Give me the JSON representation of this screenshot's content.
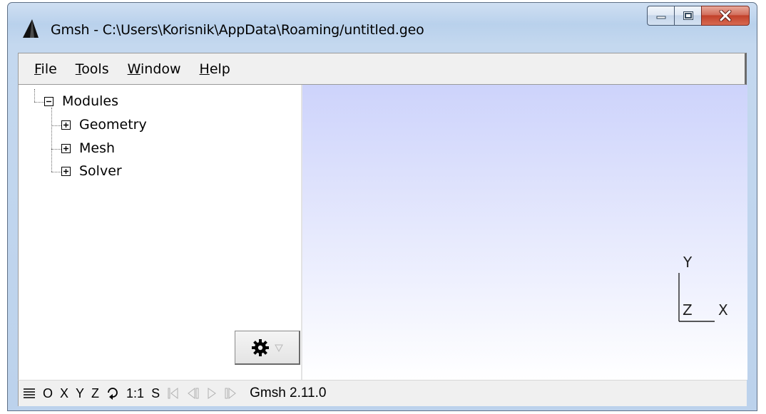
{
  "window": {
    "title": "Gmsh - C:\\Users\\Korisnik\\AppData\\Roaming/untitled.geo"
  },
  "menu": [
    {
      "label": "File",
      "mnemonic": "F",
      "rest": "ile"
    },
    {
      "label": "Tools",
      "mnemonic": "T",
      "rest": "ools"
    },
    {
      "label": "Window",
      "mnemonic": "W",
      "rest": "indow"
    },
    {
      "label": "Help",
      "mnemonic": "H",
      "rest": "elp"
    }
  ],
  "tree": {
    "root": {
      "label": "Modules",
      "expanded": true
    },
    "children": [
      {
        "label": "Geometry",
        "expanded": false
      },
      {
        "label": "Mesh",
        "expanded": false
      },
      {
        "label": "Solver",
        "expanded": false
      }
    ]
  },
  "axes": {
    "x": "X",
    "y": "Y",
    "z": "Z"
  },
  "statusbar": {
    "buttons": [
      "O",
      "X",
      "Y",
      "Z",
      "1:1",
      "S"
    ],
    "version": "Gmsh 2.11.0"
  },
  "colors": {
    "gl_top": "#cdd3fb",
    "gl_bottom": "#ffffff",
    "close_button": "#c2412a"
  }
}
